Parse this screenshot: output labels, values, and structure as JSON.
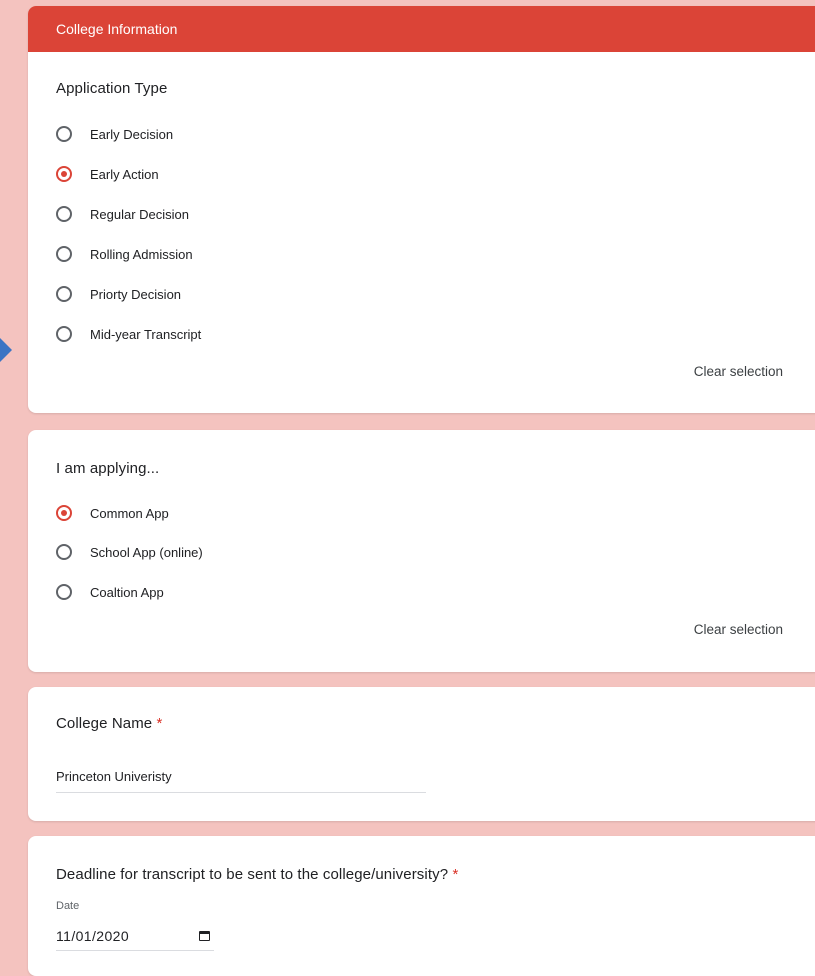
{
  "section_header": "College Information",
  "application_type": {
    "question": "Application Type",
    "options": [
      {
        "label": "Early Decision",
        "checked": false
      },
      {
        "label": "Early Action",
        "checked": true
      },
      {
        "label": "Regular Decision",
        "checked": false
      },
      {
        "label": "Rolling Admission",
        "checked": false
      },
      {
        "label": "Priorty Decision",
        "checked": false
      },
      {
        "label": "Mid-year Transcript",
        "checked": false
      }
    ],
    "clear_label": "Clear selection"
  },
  "applying": {
    "question": "I am applying...",
    "options": [
      {
        "label": "Common App",
        "checked": true
      },
      {
        "label": "School App (online)",
        "checked": false
      },
      {
        "label": "Coaltion App",
        "checked": false
      }
    ],
    "clear_label": "Clear selection"
  },
  "college_name": {
    "question": "College Name",
    "required_mark": "*",
    "value": "Princeton Univeristy"
  },
  "deadline": {
    "question": "Deadline for transcript to be sent to the college/university?",
    "required_mark": "*",
    "date_label": "Date",
    "value": "11/01/2020"
  },
  "colors": {
    "accent": "#db4437",
    "page_background": "#f4c3bf",
    "arrow": "#3b74c4"
  }
}
